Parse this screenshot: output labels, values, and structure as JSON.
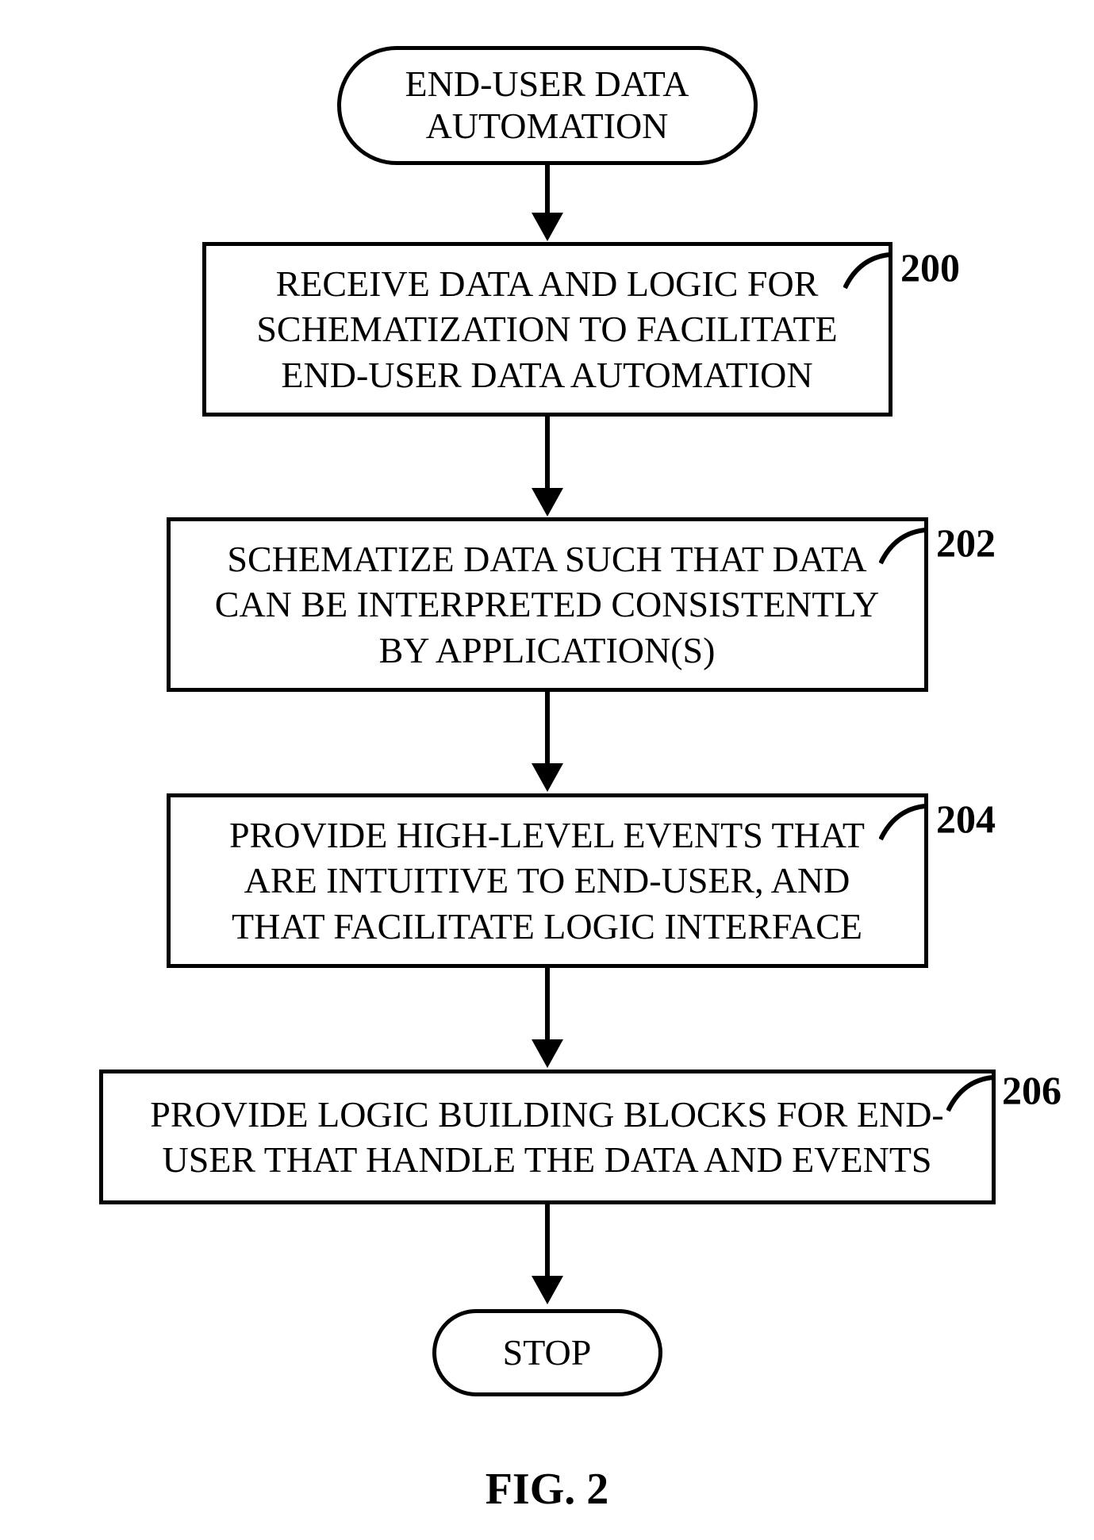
{
  "terminator_start": "END-USER DATA\nAUTOMATION",
  "terminator_stop": "STOP",
  "steps": [
    {
      "text": "RECEIVE DATA AND LOGIC FOR\nSCHEMATIZATION TO FACILITATE\nEND-USER DATA AUTOMATION",
      "ref": "200"
    },
    {
      "text": "SCHEMATIZE DATA SUCH THAT DATA\nCAN BE INTERPRETED CONSISTENTLY\nBY APPLICATION(S)",
      "ref": "202"
    },
    {
      "text": "PROVIDE HIGH-LEVEL EVENTS THAT\nARE INTUITIVE TO END-USER, AND\nTHAT FACILITATE LOGIC INTERFACE",
      "ref": "204"
    },
    {
      "text": "PROVIDE LOGIC BUILDING BLOCKS FOR END-\nUSER THAT HANDLE THE DATA AND EVENTS",
      "ref": "206"
    }
  ],
  "caption": "FIG. 2"
}
